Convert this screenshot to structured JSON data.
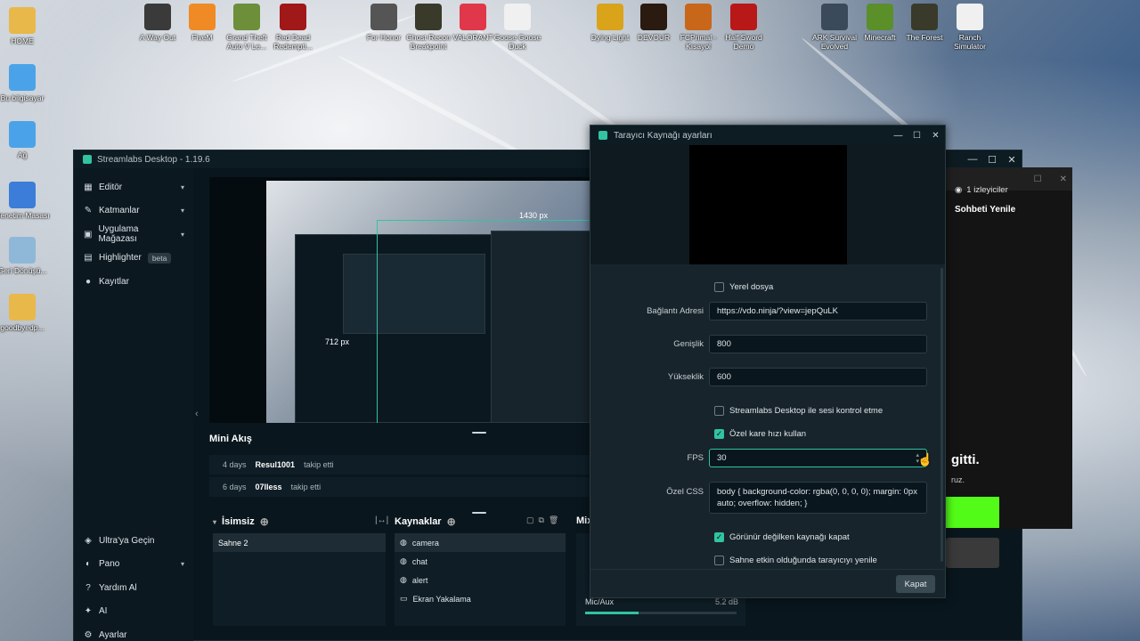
{
  "desktop_icons": [
    {
      "label": "HOME",
      "icon": "folder-icon",
      "color": "#e8b84a"
    },
    {
      "label": "Bu bilgisayar",
      "icon": "computer-icon",
      "color": "#4aa3e8"
    },
    {
      "label": "Ağ",
      "icon": "network-icon",
      "color": "#4aa3e8"
    },
    {
      "label": "Denetim Masası",
      "icon": "control-panel-icon",
      "color": "#3b7dd8"
    },
    {
      "label": "Geri Dönüşü...",
      "icon": "recycle-bin-icon",
      "color": "#8fb8d8"
    },
    {
      "label": "goodbyedp...",
      "icon": "folder-icon",
      "color": "#e8b84a"
    },
    {
      "label": "A Way Out",
      "icon": "game-icon",
      "color": "#3a3a3a"
    },
    {
      "label": "FiveM",
      "icon": "game-icon",
      "color": "#f08a24"
    },
    {
      "label": "Grand Theft Auto V Le...",
      "icon": "game-icon",
      "color": "#6d8f3a"
    },
    {
      "label": "Red Dead Redempti...",
      "icon": "game-icon",
      "color": "#a01818"
    },
    {
      "label": "For Honor",
      "icon": "game-icon",
      "color": "#555"
    },
    {
      "label": "Ghost Recon Breakpoint",
      "icon": "game-icon",
      "color": "#3a3a2a"
    },
    {
      "label": "VALORANT",
      "icon": "game-icon",
      "color": "#e0384a"
    },
    {
      "label": "Goose Goose Duck",
      "icon": "game-icon",
      "color": "#f0f0f0"
    },
    {
      "label": "Dying Light",
      "icon": "game-icon",
      "color": "#d9a31a"
    },
    {
      "label": "DEVOUR",
      "icon": "game-icon",
      "color": "#2a1a10"
    },
    {
      "label": "FCPrimal - Kısayol",
      "icon": "game-icon",
      "color": "#c8661a"
    },
    {
      "label": "Half Sword Demo",
      "icon": "game-icon",
      "color": "#b81818"
    },
    {
      "label": "ARK Survival Evolved",
      "icon": "game-icon",
      "color": "#3a4a5a"
    },
    {
      "label": "Minecraft",
      "icon": "game-icon",
      "color": "#5a8f2a"
    },
    {
      "label": "The Forest",
      "icon": "game-icon",
      "color": "#3a3a2a"
    },
    {
      "label": "Ranch Simulator",
      "icon": "game-icon",
      "color": "#f0f0f0"
    }
  ],
  "streamlabs": {
    "title": "Streamlabs Desktop - 1.19.6",
    "nav": [
      {
        "label": "Editör",
        "icon": "editor-icon",
        "has_chevron": true
      },
      {
        "label": "Katmanlar",
        "icon": "layers-icon",
        "has_chevron": true
      },
      {
        "label": "Uygulama Mağazası",
        "icon": "store-icon",
        "has_chevron": true
      },
      {
        "label": "Highlighter",
        "icon": "highlighter-icon",
        "badge": "beta"
      },
      {
        "label": "Kayıtlar",
        "icon": "recordings-icon"
      }
    ],
    "bottom_nav": [
      {
        "label": "Ultra'ya Geçin",
        "icon": "ultra-icon"
      },
      {
        "label": "Pano",
        "icon": "dashboard-icon",
        "has_chevron": true
      },
      {
        "label": "Yardım Al",
        "icon": "help-icon"
      },
      {
        "label": "AI",
        "icon": "ai-icon"
      },
      {
        "label": "Ayarlar",
        "icon": "settings-icon"
      }
    ],
    "preview": {
      "width_label": "1430 px",
      "height_label": "712 px"
    },
    "mini_feed": {
      "title": "Mini Akış",
      "items": [
        {
          "time": "4 days",
          "user": "Resul1001",
          "action": "takip etti"
        },
        {
          "time": "6 days",
          "user": "07lless",
          "action": "takip etti"
        }
      ]
    },
    "scenes": {
      "title": "İsimsiz",
      "items": [
        "Sahne 2"
      ]
    },
    "sources": {
      "title": "Kaynaklar",
      "items": [
        {
          "label": "camera",
          "icon": "globe-icon",
          "selected": true
        },
        {
          "label": "chat",
          "icon": "globe-icon"
        },
        {
          "label": "alert",
          "icon": "globe-icon"
        },
        {
          "label": "Ekran Yakalama",
          "icon": "monitor-icon"
        }
      ]
    },
    "mixer": {
      "title": "Mix",
      "channel": "Mic/Aux",
      "level": "5.2 dB"
    }
  },
  "dialog": {
    "title": "Tarayıcı Kaynağı ayarları",
    "local_file_label": "Yerel dosya",
    "local_file_checked": false,
    "url_label": "Bağlantı Adresi",
    "url_value": "https://vdo.ninja/?view=jepQuLK",
    "width_label": "Genişlik",
    "width_value": "800",
    "height_label": "Yükseklik",
    "height_value": "600",
    "control_audio_label": "Streamlabs Desktop ile sesi kontrol etme",
    "control_audio_checked": false,
    "custom_fps_label": "Özel kare hızı kullan",
    "custom_fps_checked": true,
    "fps_label": "FPS",
    "fps_value": "30",
    "css_label": "Özel CSS",
    "css_value": "body { background-color: rgba(0, 0, 0, 0); margin: 0px auto; overflow: hidden; }",
    "shutdown_label": "Görünür değilken kaynağı kapat",
    "shutdown_checked": true,
    "refresh_label": "Sahne etkin olduğunda tarayıcıyı yenile",
    "refresh_checked": false,
    "close_button": "Kapat"
  },
  "browser": {
    "viewers": "1 izleyiciler",
    "chat_refresh": "Sohbeti Yenile",
    "heading_fragment": "gitti.",
    "sub_fragment": "ruz."
  },
  "colors": {
    "accent": "#31c3a2",
    "kick_green": "#53fc18",
    "sl_bg": "#09161d"
  }
}
